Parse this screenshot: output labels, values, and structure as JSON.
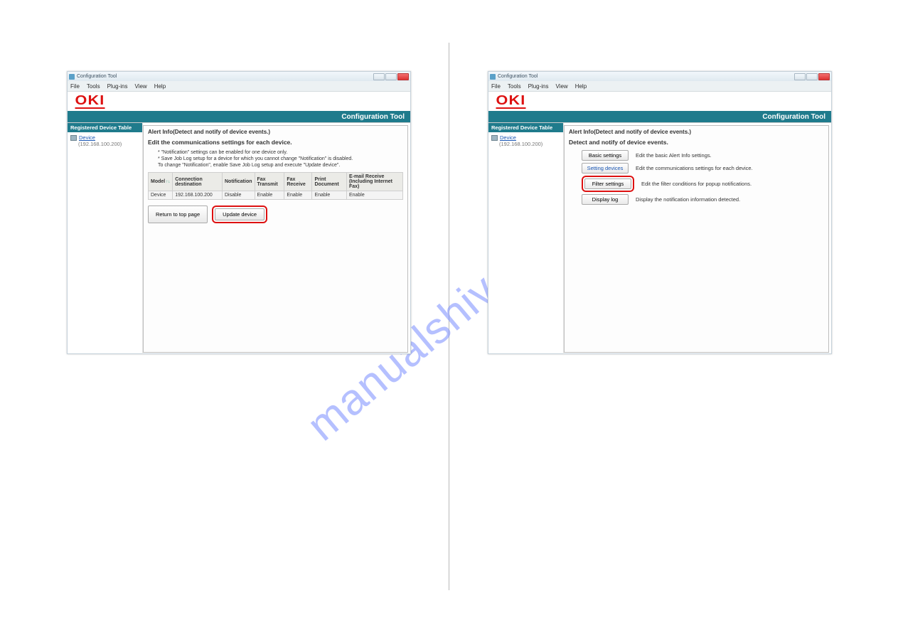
{
  "watermark": "manualshive.com",
  "window": {
    "title": "Configuration Tool",
    "menu": [
      "File",
      "Tools",
      "Plug-ins",
      "View",
      "Help"
    ],
    "logo": "OKI",
    "app_name": "Configuration Tool"
  },
  "sidebar": {
    "header": "Registered Device Table",
    "device_name": "Device",
    "device_ip": "(192.168.100.200)"
  },
  "left_panel": {
    "crumb": "Alert Info(Detect and notify of device events.)",
    "subtitle": "Edit the communications settings for each device.",
    "notes": [
      "* \"Notification\" settings can be enabled for one device only.",
      "* Save Job Log setup for a device for which you cannot change \"Notification\" is disabled.",
      "  To change \"Notification\", enable Save Job Log setup and execute \"Update device\"."
    ],
    "table": {
      "headers": [
        "Model",
        "Connection destination",
        "Notification",
        "Fax Transmit",
        "Fax Receive",
        "Print Document",
        "E-mail Receive (Including Internet Fax)"
      ],
      "row": [
        "Device",
        "192.168.100.200",
        "Disable",
        "Enable",
        "Enable",
        "Enable",
        "Enable"
      ]
    },
    "buttons": {
      "return": "Return to top page",
      "update": "Update device"
    }
  },
  "right_panel": {
    "crumb": "Alert Info(Detect and notify of device events.)",
    "subtitle": "Detect and notify of device events.",
    "options": [
      {
        "label": "Basic settings",
        "desc": "Edit the basic Alert Info settings."
      },
      {
        "label": "Setting devices",
        "desc": "Edit the communications settings for each device."
      },
      {
        "label": "Filter settings",
        "desc": "Edit the filter conditions for popup notifications."
      },
      {
        "label": "Display log",
        "desc": "Display the notification information detected."
      }
    ]
  }
}
